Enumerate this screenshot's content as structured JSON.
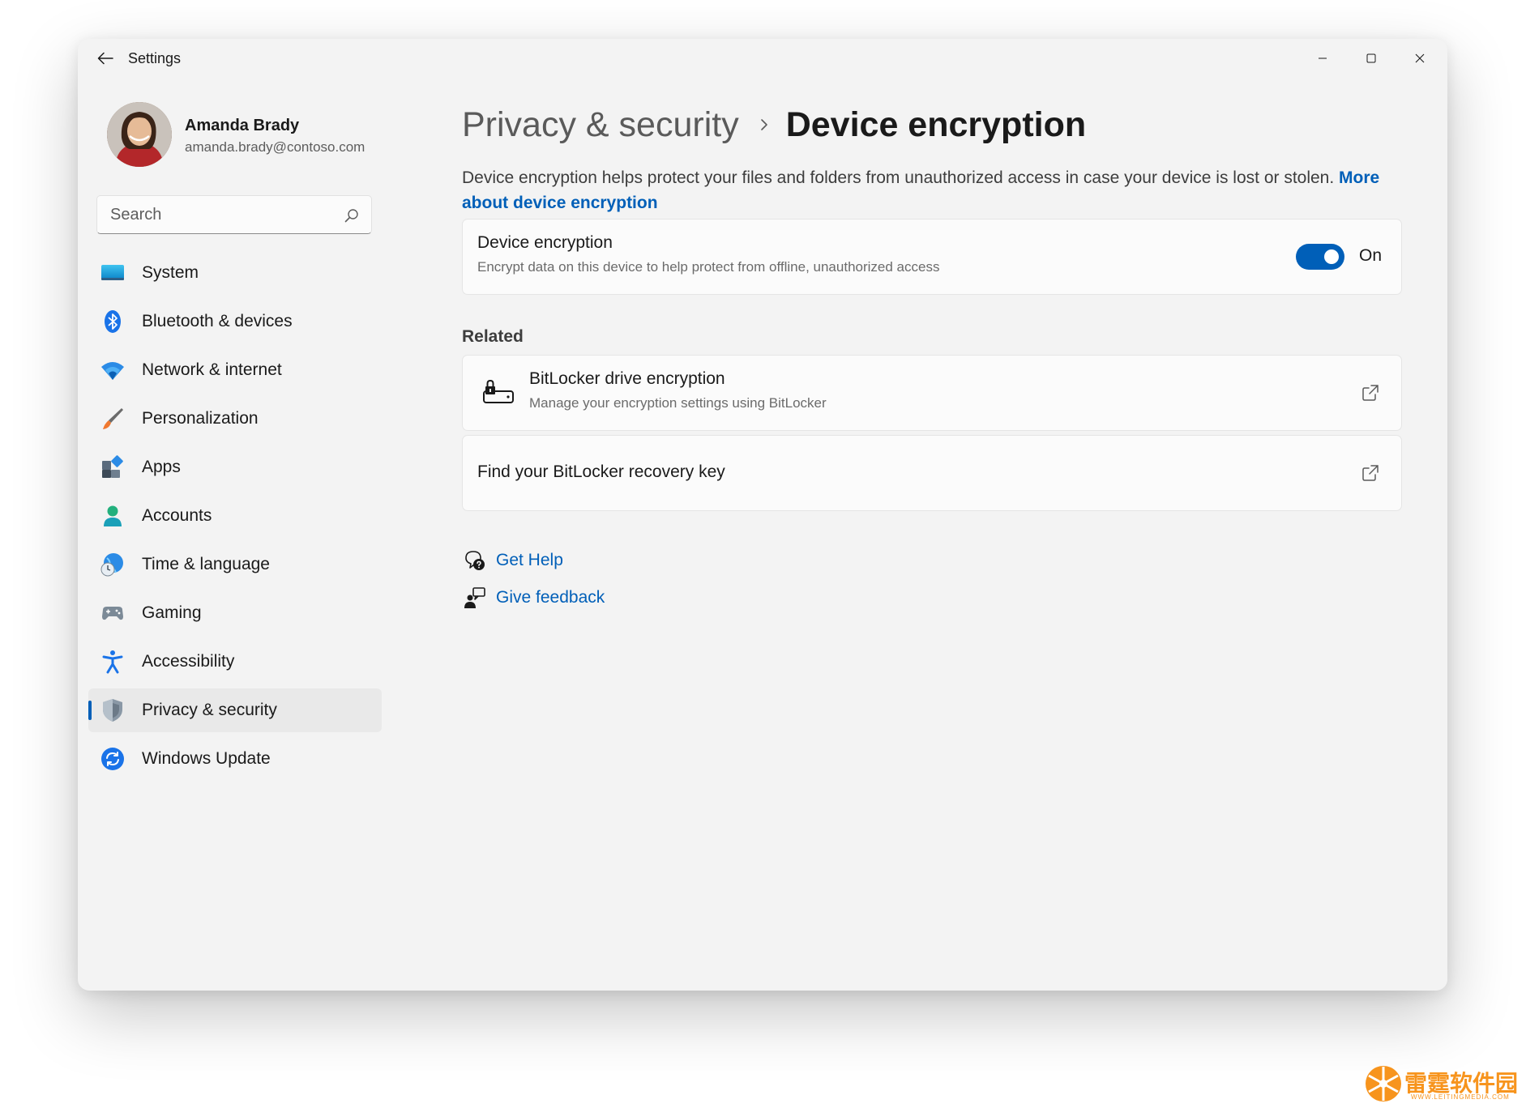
{
  "window": {
    "title": "Settings"
  },
  "profile": {
    "name": "Amanda Brady",
    "email": "amanda.brady@contoso.com"
  },
  "search": {
    "placeholder": "Search"
  },
  "nav": {
    "items": [
      {
        "label": "System",
        "icon": "system-icon"
      },
      {
        "label": "Bluetooth & devices",
        "icon": "bluetooth-icon"
      },
      {
        "label": "Network & internet",
        "icon": "wifi-icon"
      },
      {
        "label": "Personalization",
        "icon": "brush-icon"
      },
      {
        "label": "Apps",
        "icon": "apps-icon"
      },
      {
        "label": "Accounts",
        "icon": "account-icon"
      },
      {
        "label": "Time & language",
        "icon": "globe-clock-icon"
      },
      {
        "label": "Gaming",
        "icon": "gamepad-icon"
      },
      {
        "label": "Accessibility",
        "icon": "accessibility-icon"
      },
      {
        "label": "Privacy & security",
        "icon": "shield-icon",
        "selected": true
      },
      {
        "label": "Windows Update",
        "icon": "update-icon"
      }
    ]
  },
  "breadcrumb": {
    "parent": "Privacy & security",
    "current": "Device encryption"
  },
  "description": {
    "text": "Device encryption helps protect your files and folders from unauthorized access in case your device is lost or stolen.",
    "link": "More about device encryption"
  },
  "device_encryption": {
    "title": "Device encryption",
    "subtitle": "Encrypt data on this device to help protect from offline, unauthorized access",
    "toggle_state": "On",
    "enabled": true
  },
  "related": {
    "heading": "Related",
    "bitlocker": {
      "title": "BitLocker drive encryption",
      "subtitle": "Manage your encryption settings using BitLocker"
    },
    "recovery": {
      "title": "Find your BitLocker recovery key"
    }
  },
  "help": {
    "get_help": "Get Help",
    "give_feedback": "Give feedback"
  },
  "watermark": {
    "text": "雷霆软件园",
    "sub": "WWW.LEITINGMEDIA.COM"
  },
  "colors": {
    "accent": "#005fb8",
    "window_bg": "#f3f3f3",
    "card_bg": "#fbfbfb"
  }
}
